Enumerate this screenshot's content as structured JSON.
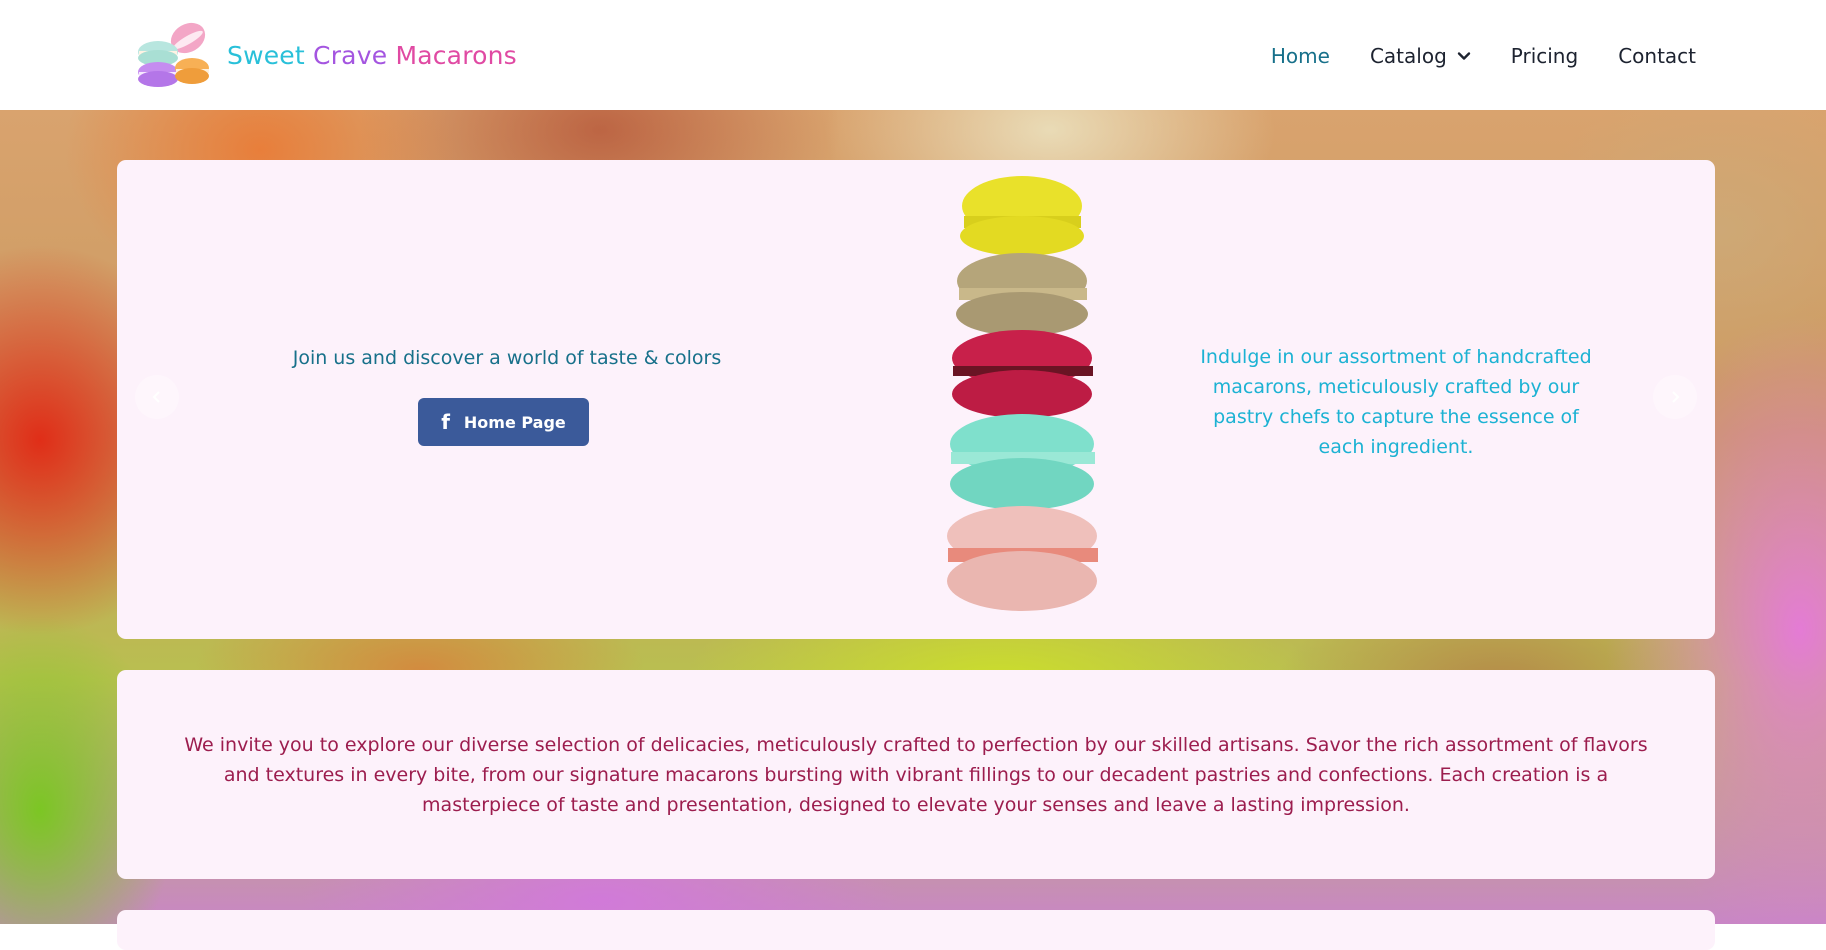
{
  "brand": {
    "word1": "Sweet",
    "word2": "Crave",
    "word3": "Macarons",
    "colors": {
      "sweet": "#29c0d9",
      "crave": "#a455e0",
      "macarons": "#e04aa3"
    }
  },
  "nav": {
    "items": [
      {
        "label": "Home",
        "active": true
      },
      {
        "label": "Catalog",
        "has_dropdown": true
      },
      {
        "label": "Pricing"
      },
      {
        "label": "Contact"
      }
    ],
    "active_color": "#17708a"
  },
  "hero": {
    "tagline": "Join us and discover a world of taste & colors",
    "button_label": "Home Page",
    "button_icon": "facebook-icon",
    "button_color": "#3b5a9a",
    "description": "Indulge in our assortment of handcrafted macarons, meticulously crafted by our pastry chefs to capture the essence of each ingredient.",
    "carousel_prev_icon": "chevron-left-icon",
    "carousel_next_icon": "chevron-right-icon"
  },
  "intro": {
    "paragraph": "We invite you to explore our diverse selection of delicacies, meticulously crafted to perfection by our skilled artisans. Savor the rich assortment of flavors and textures in every bite, from our signature macarons bursting with vibrant fillings to our decadent pastries and confections. Each creation is a masterpiece of taste and presentation, designed to elevate your senses and leave a lasting impression.",
    "text_color": "#9c1d4e"
  }
}
